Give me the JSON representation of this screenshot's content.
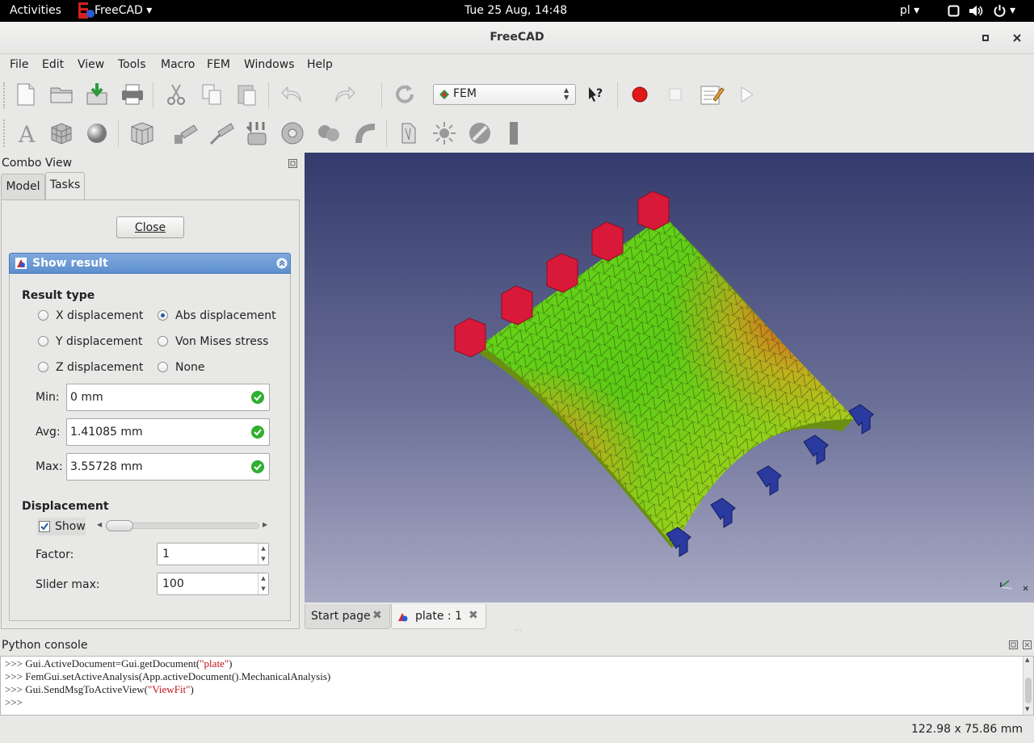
{
  "topbar": {
    "activities": "Activities",
    "app_name": "FreeCAD",
    "clock": "Tue 25 Aug, 14:48",
    "keyboard_layout": "pl"
  },
  "window": {
    "title": "FreeCAD"
  },
  "menubar": {
    "items": [
      "File",
      "Edit",
      "View",
      "Tools",
      "Macro",
      "FEM",
      "Windows",
      "Help"
    ]
  },
  "toolbar": {
    "workbench": "FEM"
  },
  "combo_view": {
    "title": "Combo View",
    "tabs": [
      "Model",
      "Tasks"
    ],
    "active_tab": "Tasks",
    "close_label": "Close"
  },
  "show_result": {
    "header": "Show result",
    "result_type_label": "Result type",
    "options": [
      "X displacement",
      "Abs displacement",
      "Y displacement",
      "Von Mises stress",
      "Z displacement",
      "None"
    ],
    "selected": "Abs displacement",
    "min_label": "Min:",
    "min_value": "0 mm",
    "avg_label": "Avg:",
    "avg_value": "1.41085 mm",
    "max_label": "Max:",
    "max_value": "3.55728 mm",
    "displacement_label": "Displacement",
    "show_label": "Show",
    "show_checked": true,
    "slider_position": 0.0,
    "factor_label": "Factor:",
    "factor_value": "1",
    "slider_max_label": "Slider max:",
    "slider_max_value": "100"
  },
  "document_tabs": [
    "Start page",
    "plate : 1"
  ],
  "active_document_tab": "plate : 1",
  "python_console": {
    "title": "Python console",
    "prompt": ">>>",
    "lines": [
      {
        "code": "Gui.ActiveDocument=Gui.getDocument(",
        "string": "\"plate\"",
        "end": ")"
      },
      {
        "code": "FemGui.setActiveAnalysis(App.activeDocument().MechanicalAnalysis)",
        "string": "",
        "end": ""
      },
      {
        "code": "Gui.SendMsgToActiveView(",
        "string": "\"ViewFit\"",
        "end": ")"
      },
      {
        "code": "",
        "string": "",
        "end": ""
      }
    ]
  },
  "status_bar": {
    "dimensions": "122.98 x 75.86 mm"
  },
  "colors": {
    "accent_header": "#5d8fce",
    "constraint_fixed": "#d8193a",
    "constraint_force": "#2a3a9e",
    "ok_check": "#2fb02f"
  }
}
